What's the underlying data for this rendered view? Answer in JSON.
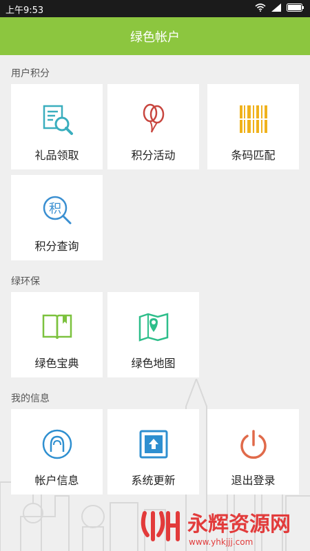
{
  "status_bar": {
    "time": "上午9:53"
  },
  "header": {
    "title": "绿色帐户"
  },
  "sections": [
    {
      "label": "用户积分"
    },
    {
      "label": "绿环保"
    },
    {
      "label": "我的信息"
    }
  ],
  "tiles": {
    "gift": {
      "label": "礼品领取",
      "icon": "gift-search-icon",
      "color": "#3aaebe"
    },
    "activity": {
      "label": "积分活动",
      "icon": "balloon-icon",
      "color": "#c8463f"
    },
    "barcode": {
      "label": "条码匹配",
      "icon": "barcode-icon",
      "color": "#f0b21c"
    },
    "points": {
      "label": "积分查询",
      "icon": "points-search-icon",
      "glyph": "积",
      "color": "#3a8fd1"
    },
    "book": {
      "label": "绿色宝典",
      "icon": "book-icon",
      "color": "#7cc23e"
    },
    "map": {
      "label": "绿色地图",
      "icon": "map-icon",
      "color": "#2dbe8a"
    },
    "account": {
      "label": "帐户信息",
      "icon": "user-icon",
      "color": "#2e8fd0"
    },
    "update": {
      "label": "系统更新",
      "icon": "update-icon",
      "color": "#2e8fd0"
    },
    "logout": {
      "label": "退出登录",
      "icon": "power-icon",
      "color": "#e06a4a"
    }
  },
  "watermark": {
    "text": "永辉资源网",
    "url": "www.yhkjjj.com"
  }
}
